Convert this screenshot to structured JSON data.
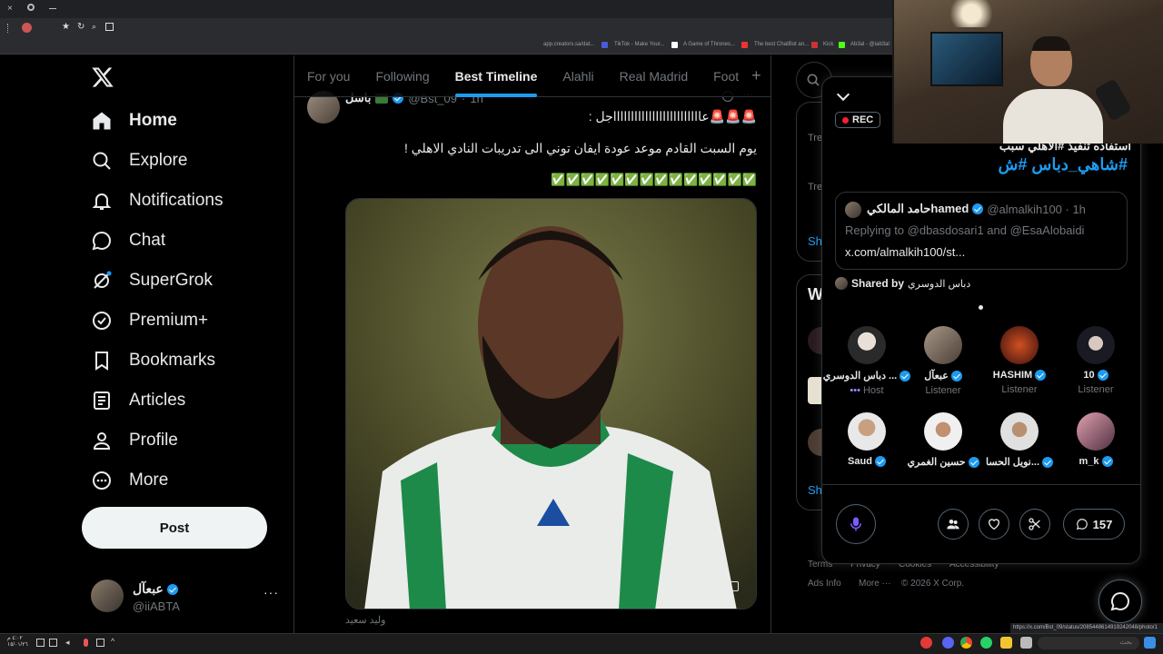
{
  "browser": {
    "bookmarks": [
      "app.creators.sa/dat...",
      "TikTok - Make Your...",
      "A Game of Thrones...",
      "The best ChatBot an...",
      "Kick",
      "Ab3al - @iab3al"
    ]
  },
  "nav": {
    "items": [
      {
        "label": "Home",
        "icon": "home-icon"
      },
      {
        "label": "Explore",
        "icon": "search-icon"
      },
      {
        "label": "Notifications",
        "icon": "bell-icon"
      },
      {
        "label": "Chat",
        "icon": "chat-bubble-icon"
      },
      {
        "label": "SuperGrok",
        "icon": "grok-icon"
      },
      {
        "label": "Premium+",
        "icon": "premium-badge-icon"
      },
      {
        "label": "Bookmarks",
        "icon": "bookmark-icon"
      },
      {
        "label": "Articles",
        "icon": "article-icon"
      },
      {
        "label": "Profile",
        "icon": "person-icon"
      },
      {
        "label": "More",
        "icon": "more-circle-icon"
      }
    ],
    "post_label": "Post",
    "account": {
      "name": "عبعآل",
      "handle": "@iiABTA"
    }
  },
  "tabs": [
    "For you",
    "Following",
    "Best Timeline",
    "Alahli",
    "Real Madrid",
    "Foot"
  ],
  "tweet": {
    "author": "باسل",
    "handle": "@Bst_09",
    "time": "1h",
    "line1": "🚨🚨🚨عاااااااااااااااااااااااااجل :",
    "line2": "يوم السبت القادم موعد عودة ايفان توني الى تدريبات النادي الاهلي !",
    "line3": "✅✅✅✅✅✅✅✅✅✅✅✅✅✅",
    "photo_credit": "وليد سعيد"
  },
  "right": {
    "trend_labels": [
      "Tre",
      "Tre"
    ],
    "show_label": "Sh",
    "who_label": "W",
    "show_label2": "Sh",
    "footer": [
      "Terms",
      "Privacy",
      "Cookies",
      "Accessibility",
      "Ads Info",
      "More ···",
      "© 2026 X Corp."
    ]
  },
  "spaces": {
    "rec_label": "REC",
    "pinned_text": "استفاده تنفيذ #الاهلي سبب",
    "hashtags": "#شاهي_دباس #ش",
    "quoted": {
      "name": "حامد المالكيhamed",
      "handle": "@almalkih100 · 1h",
      "replying": "Replying to @dbasdosari1 and @EsaAlobaidi",
      "link": "x.com/almalkih100/st..."
    },
    "shared_by_label": "Shared by",
    "shared_by_name": "دباس الدوسري",
    "participants": [
      {
        "name": "دباس الدوسري ...",
        "role": "Host"
      },
      {
        "name": "عبعآل",
        "role": "Listener"
      },
      {
        "name": "HASHIM",
        "role": "Listener"
      },
      {
        "name": "10",
        "role": "Listener"
      },
      {
        "name": "Saud",
        "role": ""
      },
      {
        "name": "حسين الغمري",
        "role": ""
      },
      {
        "name": "نويل الحسا...",
        "role": ""
      },
      {
        "name": "m_k",
        "role": ""
      }
    ],
    "reply_count": "157"
  },
  "status_url": "https://x.com/Bst_09/status/2085448614919242048/photo/1",
  "taskbar": {
    "time": "٤:٠٢ م",
    "date": "١٥/٠١/٢٦",
    "search_placeholder": "بحث"
  }
}
